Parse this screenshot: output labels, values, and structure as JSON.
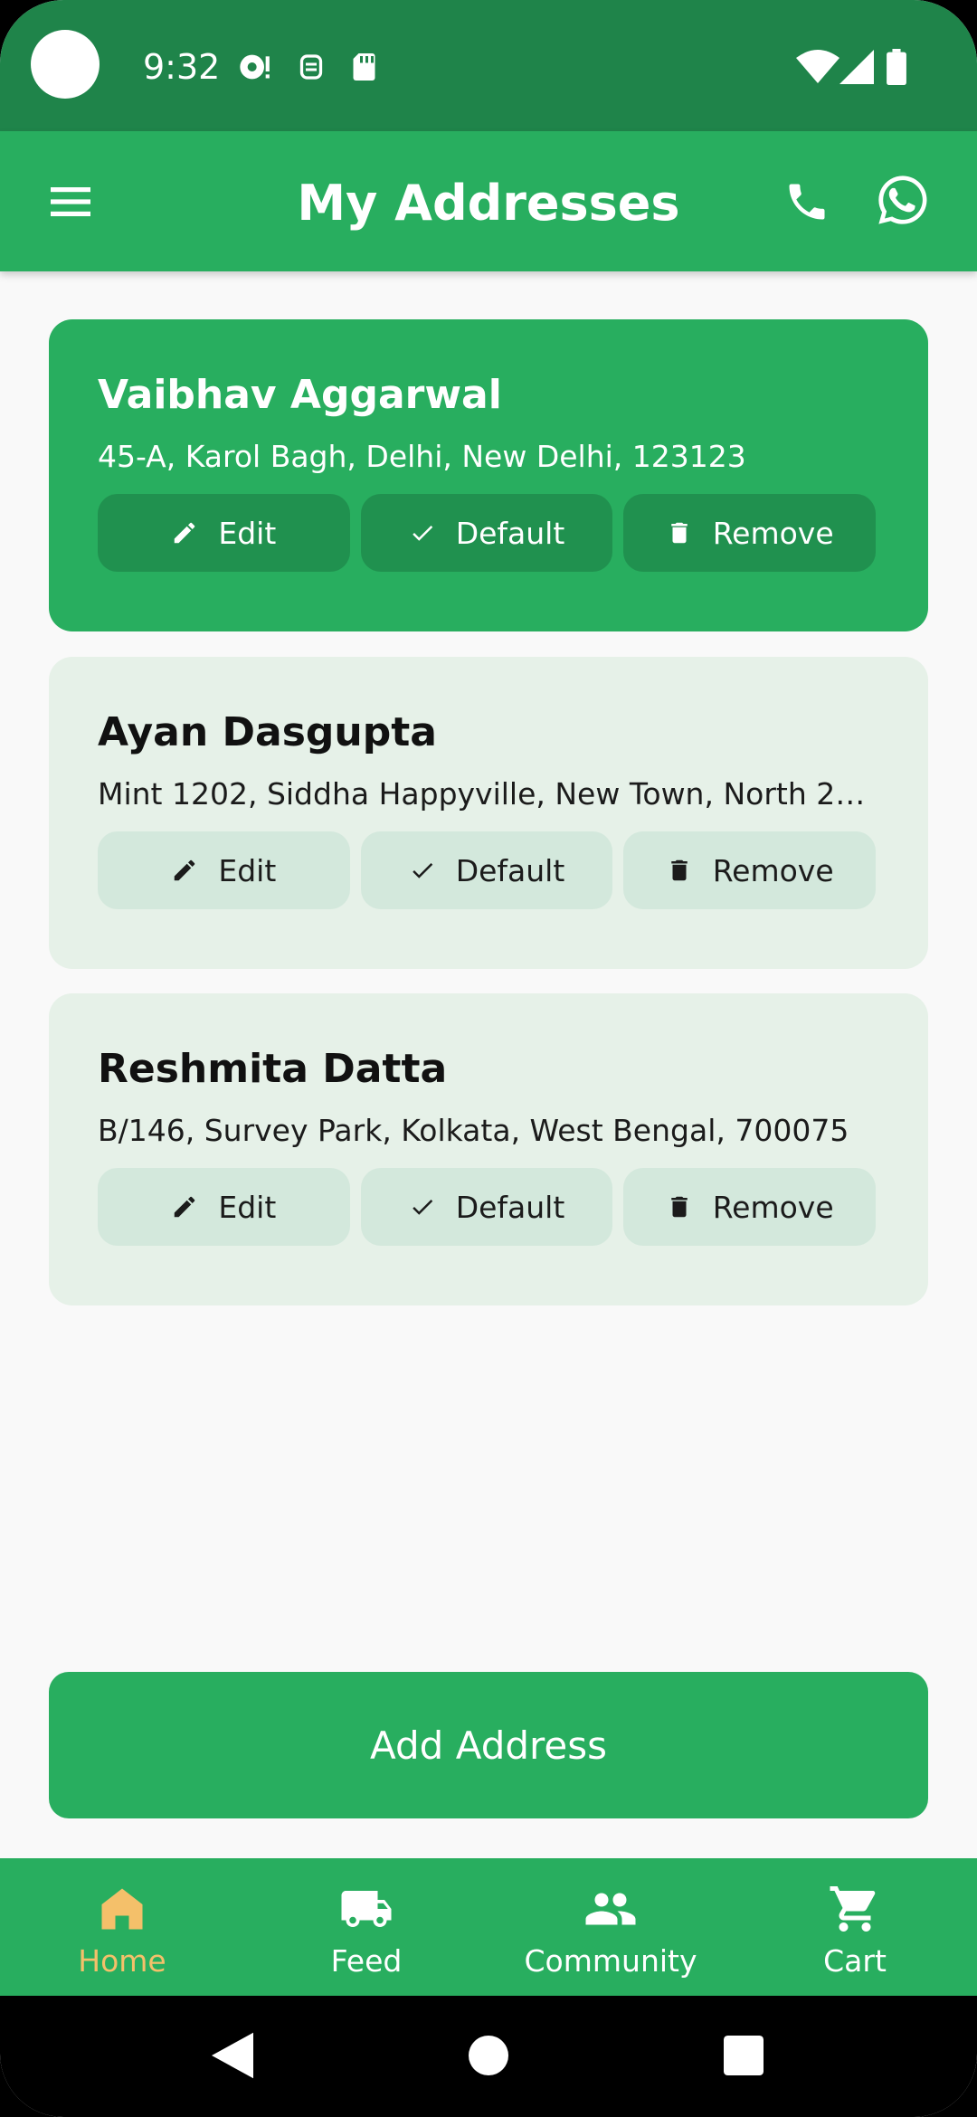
{
  "status": {
    "time": "9:32"
  },
  "app_bar": {
    "title": "My Addresses"
  },
  "addresses": [
    {
      "name": "Vaibhav Aggarwal",
      "address": "45-A, Karol Bagh, Delhi, New Delhi, 123123",
      "selected": true
    },
    {
      "name": "Ayan Dasgupta",
      "address": "Mint 1202, Siddha Happyville, New Town, North 24 …",
      "selected": false
    },
    {
      "name": "Reshmita Datta",
      "address": "B/146, Survey Park, Kolkata, West Bengal, 700075",
      "selected": false
    }
  ],
  "buttons": {
    "edit": "Edit",
    "default": "Default",
    "remove": "Remove"
  },
  "add_address_label": "Add Address",
  "bottom_nav": [
    {
      "label": "Home",
      "icon": "home-icon",
      "active": true
    },
    {
      "label": "Feed",
      "icon": "truck-icon",
      "active": false
    },
    {
      "label": "Community",
      "icon": "people-icon",
      "active": false
    },
    {
      "label": "Cart",
      "icon": "cart-icon",
      "active": false
    }
  ],
  "colors": {
    "primary": "#28ae5f",
    "status_bar": "#1f844a",
    "card_bg": "#e6f1e8",
    "button_bg": "#d3e8dc",
    "active_nav": "#f4c06a"
  }
}
